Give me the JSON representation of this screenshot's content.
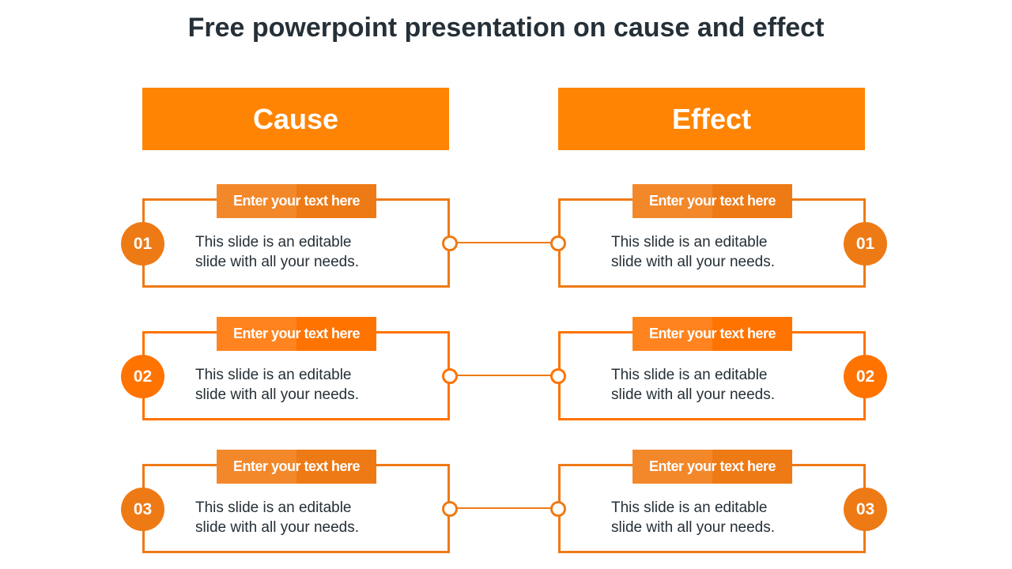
{
  "title": "Free powerpoint presentation on cause and effect",
  "colors": {
    "header": "#ff8403",
    "row_a": "#ee7a15",
    "row_b": "#ff7300",
    "text": "#253038"
  },
  "cause": {
    "header": "Cause",
    "items": [
      {
        "number": "01",
        "tag": "Enter your text here",
        "line1": "This slide is an editable",
        "line2": "slide with all your needs."
      },
      {
        "number": "02",
        "tag": "Enter your text here",
        "line1": "This slide is an editable",
        "line2": "slide with all your needs."
      },
      {
        "number": "03",
        "tag": "Enter your text here",
        "line1": "This slide is an editable",
        "line2": "slide with all your needs."
      }
    ]
  },
  "effect": {
    "header": "Effect",
    "items": [
      {
        "number": "01",
        "tag": "Enter your text here",
        "line1": "This slide is an editable",
        "line2": "slide with all your needs."
      },
      {
        "number": "02",
        "tag": "Enter your text here",
        "line1": "This slide is an editable",
        "line2": "slide with all your needs."
      },
      {
        "number": "03",
        "tag": "Enter your text here",
        "line1": "This slide is an editable",
        "line2": "slide with all your needs."
      }
    ]
  }
}
